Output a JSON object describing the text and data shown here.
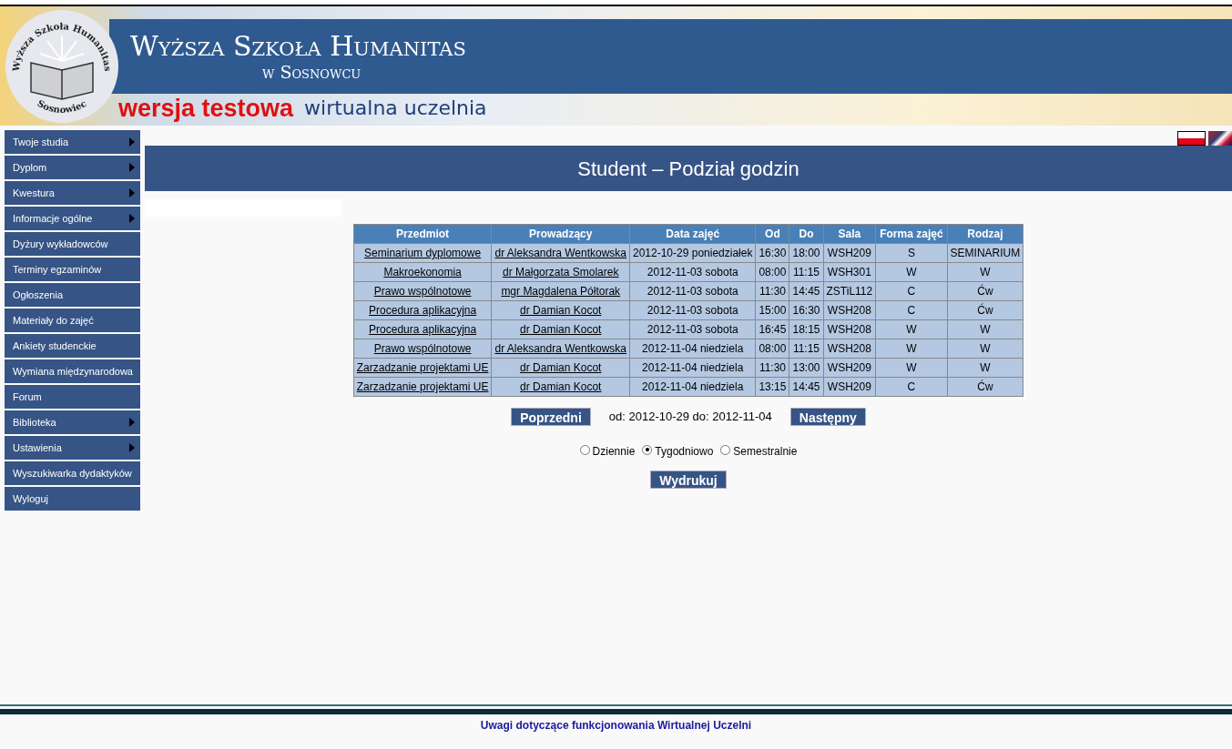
{
  "header": {
    "logo_ring_top": "Wyższa Szkoła Humanitas",
    "logo_ring_bottom": "Sosnowiec",
    "title": "Wyższa Szkoła Humanitas",
    "subtitle": "w Sosnowcu",
    "test_badge": "wersja testowa",
    "tagline": "wirtualna uczelnia"
  },
  "sidebar": {
    "items": [
      {
        "label": "Twoje studia",
        "has_submenu": true
      },
      {
        "label": "Dyplom",
        "has_submenu": true
      },
      {
        "label": "Kwestura",
        "has_submenu": true
      },
      {
        "label": "Informacje ogólne",
        "has_submenu": true
      },
      {
        "label": "Dyżury wykładowców",
        "has_submenu": false
      },
      {
        "label": "Terminy egzaminów",
        "has_submenu": false
      },
      {
        "label": "Ogłoszenia",
        "has_submenu": false
      },
      {
        "label": "Materiały do zajęć",
        "has_submenu": false
      },
      {
        "label": "Ankiety studenckie",
        "has_submenu": false
      },
      {
        "label": "Wymiana międzynarodowa",
        "has_submenu": false
      },
      {
        "label": "Forum",
        "has_submenu": false
      },
      {
        "label": "Biblioteka",
        "has_submenu": true
      },
      {
        "label": "Ustawienia",
        "has_submenu": true
      },
      {
        "label": "Wyszukiwarka dydaktyków",
        "has_submenu": false
      },
      {
        "label": "Wyloguj",
        "has_submenu": false
      }
    ]
  },
  "languages": [
    {
      "kind": "pl"
    },
    {
      "kind": "en"
    }
  ],
  "page_title": "Student – Podział godzin",
  "table": {
    "columns": [
      "Przedmiot",
      "Prowadzący",
      "Data zajęć",
      "Od",
      "Do",
      "Sala",
      "Forma zajęć",
      "Rodzaj"
    ],
    "rows": [
      [
        "Seminarium dyplomowe",
        "dr Aleksandra Wentkowska",
        "2012-10-29 poniedziałek",
        "16:30",
        "18:00",
        "WSH209",
        "S",
        "SEMINARIUM"
      ],
      [
        "Makroekonomia",
        "dr Małgorzata Smolarek",
        "2012-11-03 sobota",
        "08:00",
        "11:15",
        "WSH301",
        "W",
        "W"
      ],
      [
        "Prawo wspólnotowe",
        "mgr Magdalena Półtorak",
        "2012-11-03 sobota",
        "11:30",
        "14:45",
        "ZSTiL112",
        "C",
        "Ćw"
      ],
      [
        "Procedura aplikacyjna",
        "dr Damian Kocot",
        "2012-11-03 sobota",
        "15:00",
        "16:30",
        "WSH208",
        "C",
        "Ćw"
      ],
      [
        "Procedura aplikacyjna",
        "dr Damian Kocot",
        "2012-11-03 sobota",
        "16:45",
        "18:15",
        "WSH208",
        "W",
        "W"
      ],
      [
        "Prawo wspólnotowe",
        "dr Aleksandra Wentkowska",
        "2012-11-04 niedziela",
        "08:00",
        "11:15",
        "WSH208",
        "W",
        "W"
      ],
      [
        "Zarzadzanie projektami UE",
        "dr Damian Kocot",
        "2012-11-04 niedziela",
        "11:30",
        "13:00",
        "WSH209",
        "W",
        "W"
      ],
      [
        "Zarzadzanie projektami UE",
        "dr Damian Kocot",
        "2012-11-04 niedziela",
        "13:15",
        "14:45",
        "WSH209",
        "C",
        "Ćw"
      ]
    ]
  },
  "pager": {
    "prev": "Poprzedni",
    "range": "od: 2012-10-29 do: 2012-11-04",
    "next": "Następny"
  },
  "views": [
    {
      "label": "Dziennie",
      "selected": false
    },
    {
      "label": "Tygodniowo",
      "selected": true
    },
    {
      "label": "Semestralnie",
      "selected": false
    }
  ],
  "print_button": "Wydrukuj",
  "footer_link": "Uwagi dotyczące funkcjonowania Wirtualnej Uczelni"
}
